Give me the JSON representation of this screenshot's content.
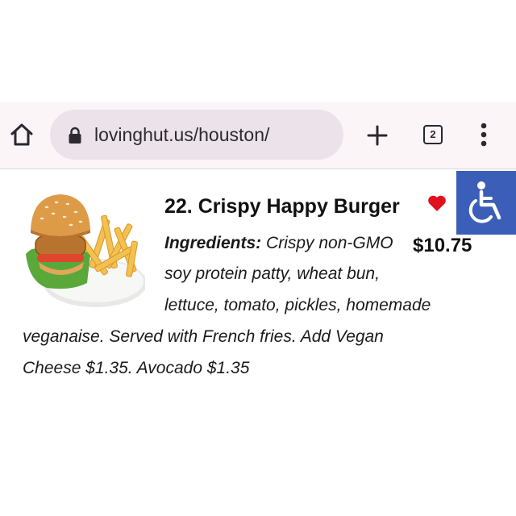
{
  "browser": {
    "url": "lovinghut.us/houston/",
    "tab_count": "2",
    "icons": {
      "home": "home-icon",
      "lock": "lock-icon",
      "new_tab": "plus-icon",
      "menu": "more-vertical-icon"
    }
  },
  "menu_item": {
    "title": "22. Crispy Happy Burger",
    "price": "$10.75",
    "ingredients_label": "Ingredients:",
    "description_lines": [
      "Crispy non-GMO",
      "soy protein patty, wheat bun,",
      "lettuce, tomato, pickles, homemade",
      "veganaise. Served with French fries. Add Vegan",
      "Cheese $1.35. Avocado $1.35"
    ],
    "favorite_icon": "heart-icon",
    "favorite_color": "#e0101d"
  },
  "accessibility": {
    "icon": "wheelchair-icon",
    "color": "#3b5fb8"
  }
}
